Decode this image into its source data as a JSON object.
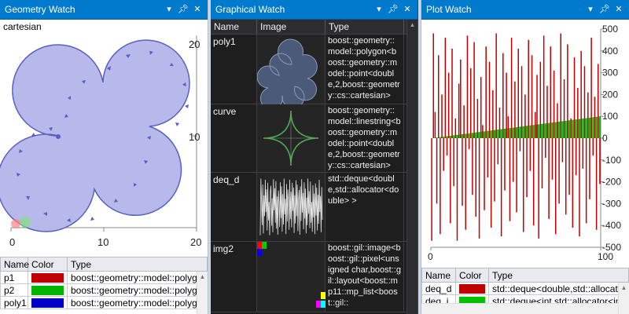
{
  "geometry_watch": {
    "title": "Geometry Watch",
    "coord_system": "cartesian",
    "x_ticks": [
      "0",
      "10",
      "20"
    ],
    "y_ticks": [
      "20",
      "10",
      "0"
    ],
    "table": {
      "headers": [
        "Name",
        "Color",
        "Type"
      ],
      "rows": [
        {
          "name": "p1",
          "color": "#c00000",
          "type": "boost::geometry::model::polygon"
        },
        {
          "name": "p2",
          "color": "#00b400",
          "type": "boost::geometry::model::polygon"
        },
        {
          "name": "poly1",
          "color": "#0000c8",
          "type": "boost::geometry::model::polygon"
        }
      ]
    },
    "colors": {
      "fill": "#b6b9ea",
      "stroke": "#5a5fc4"
    }
  },
  "graphical_watch": {
    "title": "Graphical Watch",
    "headers": [
      "Name",
      "Image",
      "Type"
    ],
    "rows": [
      {
        "name": "poly1",
        "type": "boost::geometry::model::polygon<boost::geometry::model::point<double,2,boost::geometry::cs::cartesian>"
      },
      {
        "name": "curve",
        "type": "boost::geometry::model::linestring<boost::geometry::model::point<double,2,boost::geometry::cs::cartesian>"
      },
      {
        "name": "deq_d",
        "type": "std::deque<double,std::allocator<double> >"
      },
      {
        "name": "img2",
        "type": "boost::gil::image<boost::gil::pixel<unsigned char,boost::gil::layout<boost::mp11::mp_list<boost::gil::"
      }
    ]
  },
  "plot_watch": {
    "title": "Plot Watch",
    "y_ticks": [
      "500",
      "400",
      "300",
      "200",
      "100",
      "0",
      "-100",
      "-200",
      "-300",
      "-400",
      "-500"
    ],
    "x_ticks": [
      "0",
      "100"
    ],
    "table": {
      "headers": [
        "Name",
        "Color",
        "Type"
      ],
      "rows": [
        {
          "name": "deq_d",
          "color": "#c00000",
          "type": "std::deque<double,std::allocator<double> >"
        },
        {
          "name": "deq_i",
          "color": "#00c000",
          "type": "std::deque<int,std::allocator<int> >"
        }
      ]
    },
    "chart_data": {
      "type": "bar",
      "ylim": [
        -500,
        500
      ],
      "series": [
        {
          "name": "deq_d",
          "color": "#c00000",
          "values": [
            -470,
            480,
            120,
            -300,
            380,
            -440,
            200,
            -150,
            460,
            -80,
            300,
            -390,
            410,
            -220,
            90,
            -470,
            250,
            360,
            -310,
            150,
            -420,
            470,
            -50,
            320,
            -260,
            440,
            -360,
            180,
            -460,
            280,
            60,
            -330,
            420,
            -180,
            350,
            -410,
            220,
            -290,
            480,
            -120,
            140,
            -450,
            390,
            -240,
            300,
            100,
            -380,
            460,
            -200,
            260,
            -340,
            410,
            -60,
            330,
            -430,
            200,
            -270,
            450,
            -150,
            380,
            -400,
            120,
            290,
            -460,
            350,
            -230,
            470,
            -90,
            240,
            -370,
            420,
            -190,
            310,
            -440,
            160,
            -300,
            480,
            -110,
            270,
            -350,
            430,
            -260,
            90,
            -410,
            370,
            -170,
            230,
            -450,
            400,
            -140,
            330,
            -390,
            210,
            -280,
            460,
            -80,
            190,
            -420,
            340,
            -210
          ]
        },
        {
          "name": "deq_i",
          "color": "#00c000",
          "values": "linear 0 to 100, 100 points"
        }
      ]
    }
  }
}
